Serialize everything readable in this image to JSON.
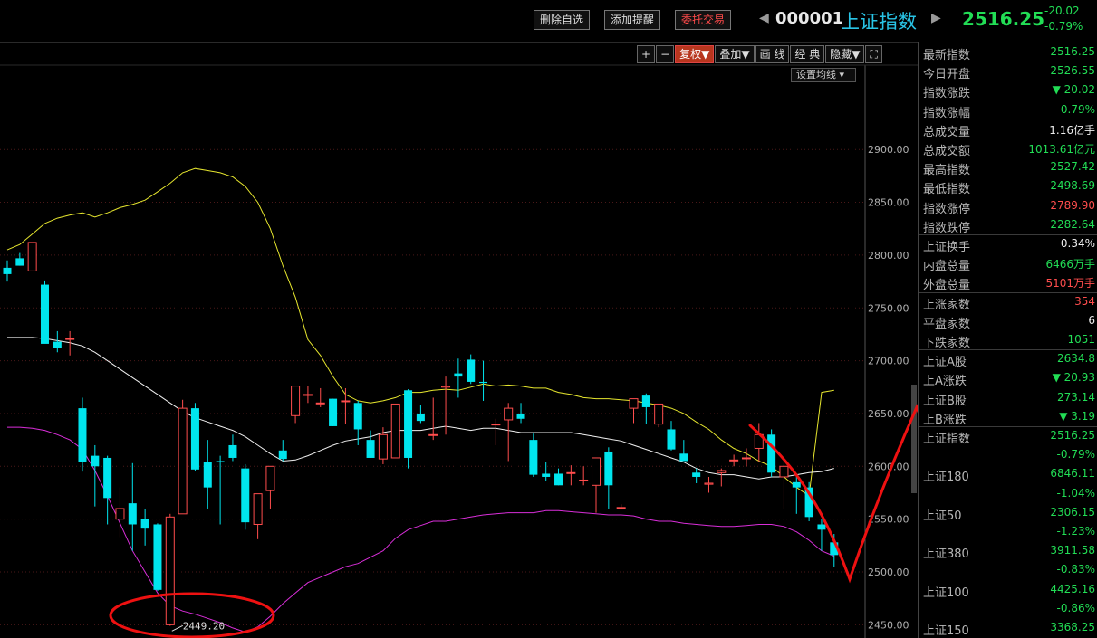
{
  "topbar": {
    "delete_watch": "删除自选",
    "add_alert": "添加提醒",
    "entrust_trade": "委托交易",
    "code": "000001",
    "name": "上证指数",
    "price": "2516.25",
    "change": "-20.02",
    "change_pct": "-0.79%",
    "prev_arrow": "◀",
    "next_arrow": "▶"
  },
  "toolbar": {
    "plus": "+",
    "minus": "−",
    "fuquan": "复权▼",
    "diejia": "叠加▼",
    "huaxian": "画 线",
    "jingdian": "经 典",
    "yincang": "隐藏▼",
    "fullscreen": "⛶",
    "set_ma": "设置均线 ▾"
  },
  "colors": {
    "up": "#ff4d4d",
    "down": "#00e5ee",
    "upper_band": "#e6e62e",
    "mid_band": "#f0f0f0",
    "lower_band": "#d92ed9",
    "annotation": "#ee1111"
  },
  "chart_data": {
    "type": "candlestick",
    "y_ticks": [
      "2900.00",
      "2850.00",
      "2800.00",
      "2750.00",
      "2700.00",
      "2650.00",
      "2600.00",
      "2550.00",
      "2500.00",
      "2450.00"
    ],
    "ylim": [
      2443,
      2950
    ],
    "low_label": "2449.20",
    "candles": [
      [
        2788,
        2795,
        2775,
        2782
      ],
      [
        2797,
        2802,
        2790,
        2790
      ],
      [
        2785,
        2812,
        2785,
        2812
      ],
      [
        2772,
        2776,
        2717,
        2716
      ],
      [
        2718,
        2728,
        2708,
        2712
      ],
      [
        2721,
        2728,
        2705,
        2721
      ],
      [
        2655,
        2665,
        2595,
        2604
      ],
      [
        2610,
        2620,
        2562,
        2600
      ],
      [
        2608,
        2610,
        2545,
        2570
      ],
      [
        2550,
        2580,
        2533,
        2560
      ],
      [
        2565,
        2603,
        2520,
        2545
      ],
      [
        2550,
        2560,
        2525,
        2541
      ],
      [
        2545,
        2546,
        2482,
        2483
      ],
      [
        2450,
        2555,
        2449,
        2552
      ],
      [
        2555,
        2663,
        2555,
        2655
      ],
      [
        2655,
        2660,
        2596,
        2597
      ],
      [
        2604,
        2625,
        2560,
        2580
      ],
      [
        2605,
        2610,
        2545,
        2604
      ],
      [
        2620,
        2630,
        2605,
        2608
      ],
      [
        2598,
        2602,
        2540,
        2547
      ],
      [
        2545,
        2574,
        2531,
        2574
      ],
      [
        2577,
        2600,
        2560,
        2600
      ],
      [
        2615,
        2625,
        2605,
        2607
      ],
      [
        2648,
        2676,
        2641,
        2676
      ],
      [
        2668,
        2676,
        2660,
        2668
      ],
      [
        2660,
        2674,
        2656,
        2660
      ],
      [
        2664,
        2664,
        2638,
        2638
      ],
      [
        2662,
        2674,
        2640,
        2662
      ],
      [
        2660,
        2662,
        2620,
        2635
      ],
      [
        2625,
        2634,
        2608,
        2608
      ],
      [
        2607,
        2637,
        2602,
        2630
      ],
      [
        2608,
        2659,
        2608,
        2659
      ],
      [
        2672,
        2673,
        2598,
        2608
      ],
      [
        2650,
        2658,
        2641,
        2643
      ],
      [
        2630,
        2665,
        2625,
        2630
      ],
      [
        2675,
        2685,
        2630,
        2676
      ],
      [
        2688,
        2702,
        2665,
        2685
      ],
      [
        2701,
        2706,
        2678,
        2680
      ],
      [
        2680,
        2700,
        2662,
        2679
      ],
      [
        2640,
        2645,
        2620,
        2640
      ],
      [
        2644,
        2660,
        2605,
        2655
      ],
      [
        2650,
        2660,
        2641,
        2645
      ],
      [
        2625,
        2631,
        2590,
        2592
      ],
      [
        2593,
        2604,
        2586,
        2590
      ],
      [
        2593,
        2598,
        2582,
        2582
      ],
      [
        2594,
        2601,
        2582,
        2594
      ],
      [
        2587,
        2600,
        2582,
        2587
      ],
      [
        2582,
        2603,
        2556,
        2608
      ],
      [
        2614,
        2618,
        2560,
        2582
      ],
      [
        2561,
        2564,
        2560,
        2561
      ],
      [
        2655,
        2662,
        2641,
        2664
      ],
      [
        2667,
        2669,
        2640,
        2656
      ],
      [
        2640,
        2659,
        2637,
        2659
      ],
      [
        2635,
        2643,
        2615,
        2616
      ],
      [
        2612,
        2625,
        2605,
        2605
      ],
      [
        2594,
        2598,
        2584,
        2590
      ],
      [
        2583,
        2590,
        2575,
        2584
      ],
      [
        2594,
        2598,
        2581,
        2596
      ],
      [
        2606,
        2611,
        2600,
        2606
      ],
      [
        2608,
        2617,
        2600,
        2608
      ],
      [
        2617,
        2641,
        2604,
        2630
      ],
      [
        2630,
        2635,
        2590,
        2594
      ],
      [
        2590,
        2608,
        2560,
        2600
      ],
      [
        2585,
        2590,
        2555,
        2580
      ],
      [
        2580,
        2585,
        2548,
        2552
      ],
      [
        2545,
        2550,
        2520,
        2540
      ],
      [
        2528,
        2536,
        2505,
        2516
      ]
    ],
    "upper": [
      2805,
      2810,
      2820,
      2830,
      2835,
      2838,
      2840,
      2836,
      2840,
      2845,
      2848,
      2852,
      2860,
      2868,
      2878,
      2882,
      2880,
      2878,
      2874,
      2865,
      2850,
      2825,
      2790,
      2760,
      2720,
      2705,
      2685,
      2668,
      2662,
      2660,
      2662,
      2665,
      2670,
      2670,
      2672,
      2673,
      2672,
      2675,
      2678,
      2676,
      2677,
      2676,
      2674,
      2674,
      2670,
      2668,
      2665,
      2664,
      2664,
      2663,
      2662,
      2660,
      2658,
      2655,
      2650,
      2642,
      2635,
      2625,
      2617,
      2612,
      2605,
      2600,
      2590,
      2580,
      2572,
      2670,
      2672
    ],
    "mid": [
      2722,
      2722,
      2722,
      2721,
      2719,
      2717,
      2714,
      2708,
      2700,
      2692,
      2684,
      2676,
      2668,
      2660,
      2652,
      2646,
      2642,
      2638,
      2634,
      2628,
      2620,
      2612,
      2605,
      2606,
      2610,
      2615,
      2620,
      2624,
      2626,
      2628,
      2632,
      2634,
      2634,
      2634,
      2636,
      2638,
      2636,
      2634,
      2636,
      2636,
      2634,
      2632,
      2632,
      2632,
      2632,
      2632,
      2630,
      2628,
      2626,
      2624,
      2620,
      2616,
      2612,
      2608,
      2604,
      2598,
      2594,
      2592,
      2592,
      2590,
      2588,
      2590,
      2590,
      2592,
      2594,
      2595,
      2598
    ],
    "lower": [
      2637,
      2637,
      2636,
      2634,
      2630,
      2625,
      2616,
      2596,
      2572,
      2546,
      2520,
      2500,
      2480,
      2468,
      2463,
      2460,
      2456,
      2452,
      2447,
      2443,
      2448,
      2458,
      2470,
      2480,
      2490,
      2495,
      2500,
      2505,
      2508,
      2514,
      2520,
      2532,
      2540,
      2544,
      2548,
      2548,
      2550,
      2552,
      2554,
      2555,
      2556,
      2556,
      2556,
      2558,
      2558,
      2557,
      2556,
      2555,
      2554,
      2554,
      2553,
      2550,
      2548,
      2548,
      2546,
      2545,
      2544,
      2543,
      2543,
      2544,
      2545,
      2545,
      2543,
      2538,
      2530,
      2520,
      2515
    ],
    "x_start": 8,
    "x_step": 13.83
  },
  "panel": {
    "rows": [
      {
        "label": "最新指数",
        "value": "2516.25",
        "cls": "down"
      },
      {
        "label": "今日开盘",
        "value": "2526.55",
        "cls": "down"
      },
      {
        "label": "指数涨跌",
        "value": "▼ 20.02",
        "cls": "down"
      },
      {
        "label": "指数涨幅",
        "value": "-0.79%",
        "cls": "down"
      },
      {
        "label": "总成交量",
        "value": "1.16亿手",
        "cls": "white"
      },
      {
        "label": "总成交额",
        "value": "1013.61亿元",
        "cls": "down"
      },
      {
        "label": "最高指数",
        "value": "2527.42",
        "cls": "down"
      },
      {
        "label": "最低指数",
        "value": "2498.69",
        "cls": "down"
      },
      {
        "label": "指数涨停",
        "value": "2789.90",
        "cls": "up"
      },
      {
        "label": "指数跌停",
        "value": "2282.64",
        "cls": "down"
      },
      {
        "label": "上证换手",
        "value": "0.34%",
        "cls": "white"
      },
      {
        "label": "内盘总量",
        "value": "6466万手",
        "cls": "down"
      },
      {
        "label": "外盘总量",
        "value": "5101万手",
        "cls": "up"
      },
      {
        "label": "上涨家数",
        "value": "354",
        "cls": "up"
      },
      {
        "label": "平盘家数",
        "value": "6",
        "cls": "white"
      },
      {
        "label": "下跌家数",
        "value": "1051",
        "cls": "down"
      },
      {
        "label": "上证A股",
        "value": "2634.8",
        "cls": "down"
      },
      {
        "label": "上A涨跌",
        "value": "▼ 20.93",
        "cls": "down"
      },
      {
        "label": "上证B股",
        "value": "273.14",
        "cls": "down"
      },
      {
        "label": "上B涨跌",
        "value": "▼ 3.19",
        "cls": "down"
      },
      {
        "label": "上证指数",
        "value": "2516.25",
        "cls": "down"
      },
      {
        "label": "",
        "value": "-0.79%",
        "cls": "down"
      },
      {
        "label": "上证180",
        "value": "6846.11",
        "cls": "down"
      },
      {
        "label": "",
        "value": "-1.04%",
        "cls": "down"
      },
      {
        "label": "上证50",
        "value": "2306.15",
        "cls": "down"
      },
      {
        "label": "",
        "value": "-1.23%",
        "cls": "down"
      },
      {
        "label": "上证380",
        "value": "3911.58",
        "cls": "down"
      },
      {
        "label": "",
        "value": "-0.83%",
        "cls": "down"
      },
      {
        "label": "上证100",
        "value": "4425.16",
        "cls": "down"
      },
      {
        "label": "",
        "value": "-0.86%",
        "cls": "down"
      },
      {
        "label": "上证150",
        "value": "3368.25",
        "cls": "down"
      }
    ]
  }
}
